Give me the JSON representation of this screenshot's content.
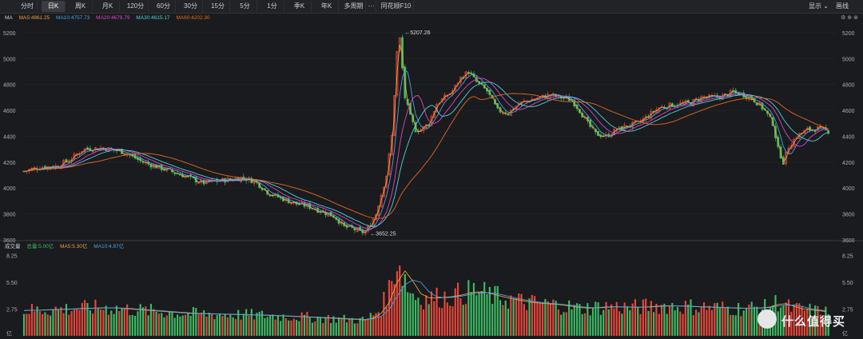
{
  "toolbar": {
    "tabs": [
      "分时",
      "日K",
      "周K",
      "月K",
      "120分",
      "60分",
      "30分",
      "15分",
      "5分",
      "1分",
      "季K",
      "年K",
      "多周期",
      "···",
      "同花顺F10"
    ],
    "active_tab": "日K",
    "display_label": "显示",
    "draw_label": "画线"
  },
  "price_panel": {
    "ma_title": "MA",
    "ma5": "MA5:4861.25",
    "ma10": "MA10:4757.73",
    "ma20": "MA20:4679.79",
    "ma30": "MA30:4615.17",
    "ma60": "MA60:4202.30",
    "high_label": "5207.26",
    "low_label": "3652.25",
    "y_ticks": [
      "5200",
      "5000",
      "4800",
      "4600",
      "4400",
      "4200",
      "4000",
      "3800",
      "3600"
    ]
  },
  "volume_panel": {
    "title": "成交量",
    "total": "总量:5.00亿",
    "ma5": "MA5:5.30亿",
    "ma10": "MA10:4.87亿",
    "y_ticks": [
      "8.25",
      "5.50",
      "2.75",
      "亿"
    ]
  },
  "colors": {
    "up": "#e8463a",
    "down": "#3dbb63",
    "ma5": "#e6a23c",
    "ma10": "#4a9fe8",
    "ma20": "#d548c9",
    "ma30": "#4fd0d9",
    "ma60": "#e06b23"
  },
  "chart_data": {
    "type": "candlestick",
    "price_range": [
      3600,
      5280
    ],
    "volume_range": [
      0,
      8.6
    ],
    "close_anchors": [
      [
        0,
        4130
      ],
      [
        12,
        4160
      ],
      [
        25,
        4170
      ],
      [
        35,
        4220
      ],
      [
        45,
        4300
      ],
      [
        60,
        4310
      ],
      [
        75,
        4280
      ],
      [
        90,
        4200
      ],
      [
        105,
        4150
      ],
      [
        120,
        4100
      ],
      [
        135,
        4040
      ],
      [
        150,
        4060
      ],
      [
        165,
        4080
      ],
      [
        175,
        4050
      ],
      [
        185,
        3960
      ],
      [
        195,
        3920
      ],
      [
        205,
        3880
      ],
      [
        215,
        3860
      ],
      [
        225,
        3820
      ],
      [
        235,
        3780
      ],
      [
        242,
        3700
      ],
      [
        248,
        3690
      ],
      [
        254,
        3660
      ],
      [
        258,
        3660
      ],
      [
        262,
        3720
      ],
      [
        266,
        3800
      ],
      [
        270,
        3950
      ],
      [
        274,
        4100
      ],
      [
        278,
        4400
      ],
      [
        282,
        5050
      ],
      [
        284,
        5150
      ],
      [
        288,
        4700
      ],
      [
        292,
        4550
      ],
      [
        296,
        4450
      ],
      [
        300,
        4450
      ],
      [
        306,
        4500
      ],
      [
        312,
        4650
      ],
      [
        318,
        4700
      ],
      [
        324,
        4750
      ],
      [
        330,
        4850
      ],
      [
        336,
        4900
      ],
      [
        342,
        4820
      ],
      [
        350,
        4750
      ],
      [
        358,
        4600
      ],
      [
        366,
        4580
      ],
      [
        374,
        4650
      ],
      [
        382,
        4680
      ],
      [
        390,
        4700
      ],
      [
        398,
        4720
      ],
      [
        406,
        4700
      ],
      [
        414,
        4680
      ],
      [
        420,
        4600
      ],
      [
        426,
        4500
      ],
      [
        432,
        4420
      ],
      [
        440,
        4400
      ],
      [
        448,
        4450
      ],
      [
        456,
        4480
      ],
      [
        464,
        4500
      ],
      [
        472,
        4560
      ],
      [
        480,
        4620
      ],
      [
        488,
        4640
      ],
      [
        496,
        4650
      ],
      [
        504,
        4660
      ],
      [
        512,
        4700
      ],
      [
        520,
        4700
      ],
      [
        528,
        4710
      ],
      [
        536,
        4740
      ],
      [
        544,
        4720
      ],
      [
        552,
        4680
      ],
      [
        560,
        4600
      ],
      [
        566,
        4500
      ],
      [
        570,
        4300
      ],
      [
        574,
        4200
      ],
      [
        578,
        4320
      ],
      [
        584,
        4400
      ],
      [
        592,
        4450
      ],
      [
        600,
        4460
      ],
      [
        608,
        4440
      ]
    ],
    "volume_anchors": [
      [
        0,
        2.6
      ],
      [
        60,
        2.9
      ],
      [
        120,
        2.3
      ],
      [
        180,
        2.1
      ],
      [
        230,
        1.8
      ],
      [
        258,
        1.6
      ],
      [
        270,
        2.8
      ],
      [
        278,
        5.5
      ],
      [
        282,
        8.0
      ],
      [
        286,
        6.5
      ],
      [
        292,
        4.5
      ],
      [
        300,
        3.8
      ],
      [
        320,
        4.0
      ],
      [
        340,
        4.6
      ],
      [
        360,
        3.9
      ],
      [
        380,
        3.4
      ],
      [
        400,
        3.2
      ],
      [
        420,
        2.8
      ],
      [
        440,
        3.0
      ],
      [
        460,
        2.9
      ],
      [
        480,
        3.1
      ],
      [
        500,
        3.0
      ],
      [
        520,
        2.9
      ],
      [
        540,
        2.8
      ],
      [
        560,
        2.9
      ],
      [
        570,
        3.5
      ],
      [
        580,
        2.8
      ],
      [
        608,
        2.4
      ]
    ]
  }
}
